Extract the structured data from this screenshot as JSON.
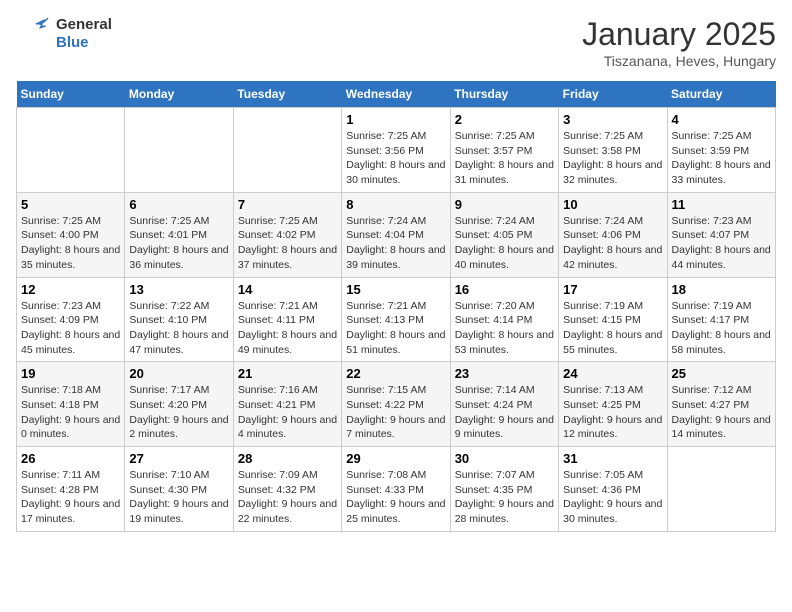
{
  "logo": {
    "general": "General",
    "blue": "Blue"
  },
  "title": "January 2025",
  "subtitle": "Tiszanana, Heves, Hungary",
  "weekdays": [
    "Sunday",
    "Monday",
    "Tuesday",
    "Wednesday",
    "Thursday",
    "Friday",
    "Saturday"
  ],
  "weeks": [
    [
      null,
      null,
      null,
      {
        "day": 1,
        "sunrise": "7:25 AM",
        "sunset": "3:56 PM",
        "daylight": "8 hours and 30 minutes."
      },
      {
        "day": 2,
        "sunrise": "7:25 AM",
        "sunset": "3:57 PM",
        "daylight": "8 hours and 31 minutes."
      },
      {
        "day": 3,
        "sunrise": "7:25 AM",
        "sunset": "3:58 PM",
        "daylight": "8 hours and 32 minutes."
      },
      {
        "day": 4,
        "sunrise": "7:25 AM",
        "sunset": "3:59 PM",
        "daylight": "8 hours and 33 minutes."
      }
    ],
    [
      {
        "day": 5,
        "sunrise": "7:25 AM",
        "sunset": "4:00 PM",
        "daylight": "8 hours and 35 minutes."
      },
      {
        "day": 6,
        "sunrise": "7:25 AM",
        "sunset": "4:01 PM",
        "daylight": "8 hours and 36 minutes."
      },
      {
        "day": 7,
        "sunrise": "7:25 AM",
        "sunset": "4:02 PM",
        "daylight": "8 hours and 37 minutes."
      },
      {
        "day": 8,
        "sunrise": "7:24 AM",
        "sunset": "4:04 PM",
        "daylight": "8 hours and 39 minutes."
      },
      {
        "day": 9,
        "sunrise": "7:24 AM",
        "sunset": "4:05 PM",
        "daylight": "8 hours and 40 minutes."
      },
      {
        "day": 10,
        "sunrise": "7:24 AM",
        "sunset": "4:06 PM",
        "daylight": "8 hours and 42 minutes."
      },
      {
        "day": 11,
        "sunrise": "7:23 AM",
        "sunset": "4:07 PM",
        "daylight": "8 hours and 44 minutes."
      }
    ],
    [
      {
        "day": 12,
        "sunrise": "7:23 AM",
        "sunset": "4:09 PM",
        "daylight": "8 hours and 45 minutes."
      },
      {
        "day": 13,
        "sunrise": "7:22 AM",
        "sunset": "4:10 PM",
        "daylight": "8 hours and 47 minutes."
      },
      {
        "day": 14,
        "sunrise": "7:21 AM",
        "sunset": "4:11 PM",
        "daylight": "8 hours and 49 minutes."
      },
      {
        "day": 15,
        "sunrise": "7:21 AM",
        "sunset": "4:13 PM",
        "daylight": "8 hours and 51 minutes."
      },
      {
        "day": 16,
        "sunrise": "7:20 AM",
        "sunset": "4:14 PM",
        "daylight": "8 hours and 53 minutes."
      },
      {
        "day": 17,
        "sunrise": "7:19 AM",
        "sunset": "4:15 PM",
        "daylight": "8 hours and 55 minutes."
      },
      {
        "day": 18,
        "sunrise": "7:19 AM",
        "sunset": "4:17 PM",
        "daylight": "8 hours and 58 minutes."
      }
    ],
    [
      {
        "day": 19,
        "sunrise": "7:18 AM",
        "sunset": "4:18 PM",
        "daylight": "9 hours and 0 minutes."
      },
      {
        "day": 20,
        "sunrise": "7:17 AM",
        "sunset": "4:20 PM",
        "daylight": "9 hours and 2 minutes."
      },
      {
        "day": 21,
        "sunrise": "7:16 AM",
        "sunset": "4:21 PM",
        "daylight": "9 hours and 4 minutes."
      },
      {
        "day": 22,
        "sunrise": "7:15 AM",
        "sunset": "4:22 PM",
        "daylight": "9 hours and 7 minutes."
      },
      {
        "day": 23,
        "sunrise": "7:14 AM",
        "sunset": "4:24 PM",
        "daylight": "9 hours and 9 minutes."
      },
      {
        "day": 24,
        "sunrise": "7:13 AM",
        "sunset": "4:25 PM",
        "daylight": "9 hours and 12 minutes."
      },
      {
        "day": 25,
        "sunrise": "7:12 AM",
        "sunset": "4:27 PM",
        "daylight": "9 hours and 14 minutes."
      }
    ],
    [
      {
        "day": 26,
        "sunrise": "7:11 AM",
        "sunset": "4:28 PM",
        "daylight": "9 hours and 17 minutes."
      },
      {
        "day": 27,
        "sunrise": "7:10 AM",
        "sunset": "4:30 PM",
        "daylight": "9 hours and 19 minutes."
      },
      {
        "day": 28,
        "sunrise": "7:09 AM",
        "sunset": "4:32 PM",
        "daylight": "9 hours and 22 minutes."
      },
      {
        "day": 29,
        "sunrise": "7:08 AM",
        "sunset": "4:33 PM",
        "daylight": "9 hours and 25 minutes."
      },
      {
        "day": 30,
        "sunrise": "7:07 AM",
        "sunset": "4:35 PM",
        "daylight": "9 hours and 28 minutes."
      },
      {
        "day": 31,
        "sunrise": "7:05 AM",
        "sunset": "4:36 PM",
        "daylight": "9 hours and 30 minutes."
      },
      null
    ]
  ]
}
